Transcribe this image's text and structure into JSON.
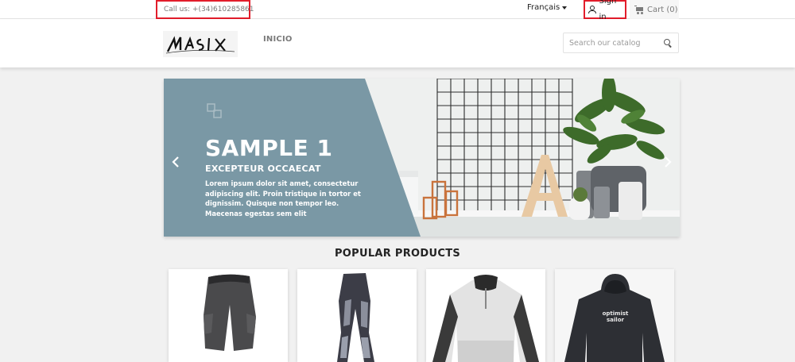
{
  "topbar": {
    "contact": "Call us: +(34)610285861",
    "language": "Français",
    "signin": "Sign in",
    "cart": "Cart (0)"
  },
  "header": {
    "logo_alt": "Masix",
    "nav": [
      {
        "label": "INICIO"
      }
    ],
    "search_placeholder": "Search our catalog"
  },
  "slider": {
    "title": "SAMPLE 1",
    "subtitle": "EXCEPTEUR OCCAECAT",
    "description": "Lorem ipsum dolor sit amet, consectetur adipiscing elit. Proin tristique in tortor et dignissim. Quisque non tempor leo. Maecenas egestas sem elit",
    "panel_color": "#7a98a5"
  },
  "popular": {
    "title": "POPULAR PRODUCTS",
    "products": [
      {
        "name": "shorts"
      },
      {
        "name": "wetsuit-leggings"
      },
      {
        "name": "spray-top"
      },
      {
        "name": "hoodie",
        "print": "optimist sailor"
      }
    ]
  },
  "colors": {
    "highlight_border": "#e21d2b",
    "background": "#f1f1f1"
  }
}
